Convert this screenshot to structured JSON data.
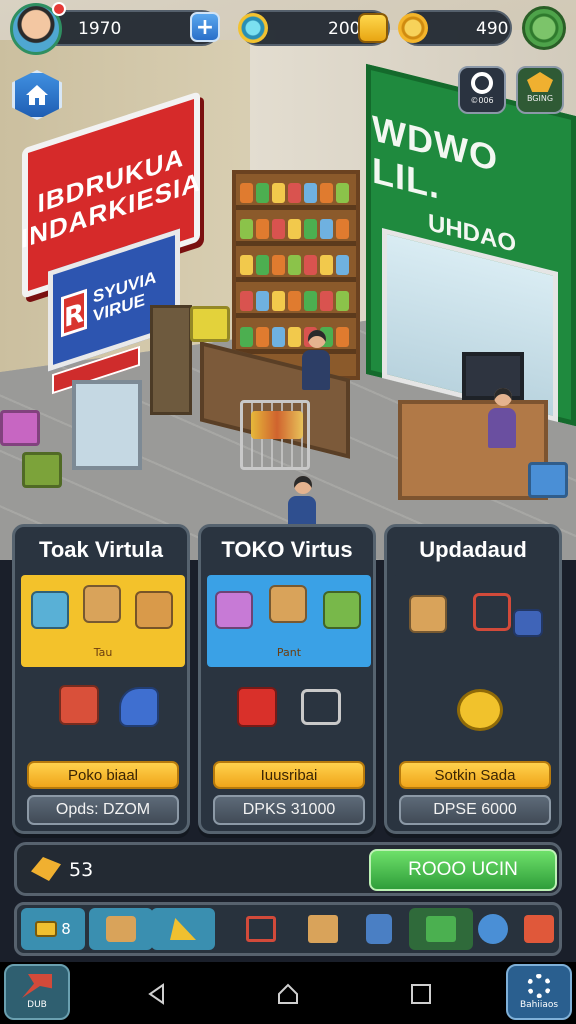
{
  "hud": {
    "cash_value": "1970",
    "gem_value": "200",
    "coin_value": "490",
    "square_btn_1_label": "©006",
    "square_btn_2_label": "BGING",
    "icons": [
      "avatar",
      "plus-icon",
      "compass-icon",
      "bolt-icon",
      "coin-icon",
      "gear-icon",
      "home-icon"
    ]
  },
  "scene": {
    "red_sign": "IBDRUKUA INDARKIESIA",
    "blue_sign": "SYUVIA VIRUE",
    "blue_sign_letter": "R",
    "green_sign_big": "WDWO LIL.",
    "green_sign_small": "UHDAO"
  },
  "cards": [
    {
      "title": "Toak Virtula",
      "panel_label": "Tau",
      "panel_color": "#f3c22b",
      "gold_label": "Poko biaal",
      "price_label": "Opds: DZOM"
    },
    {
      "title": "TOKO Virtus",
      "panel_label": "Pant",
      "panel_color": "#3aa1e6",
      "gold_label": "Iuusribai",
      "price_label": "DPKS 31000"
    },
    {
      "title": "Updadaud",
      "panel_label": "",
      "panel_color": "#2a3440",
      "gold_label": "Sotkin Sada",
      "price_label": "DPSE 6000"
    }
  ],
  "balance": {
    "value": "53",
    "button_label": "ROOO UCIN"
  },
  "tray": {
    "first_slot_text": "8"
  },
  "corner_buttons": {
    "left_label": "DUB",
    "right_label": "Bahiiaos"
  },
  "colors": {
    "accent_gold": "#f0a51a",
    "accent_green": "#2f9e3a",
    "accent_blue": "#2a6fc9",
    "panel_dark": "#2a3440"
  }
}
